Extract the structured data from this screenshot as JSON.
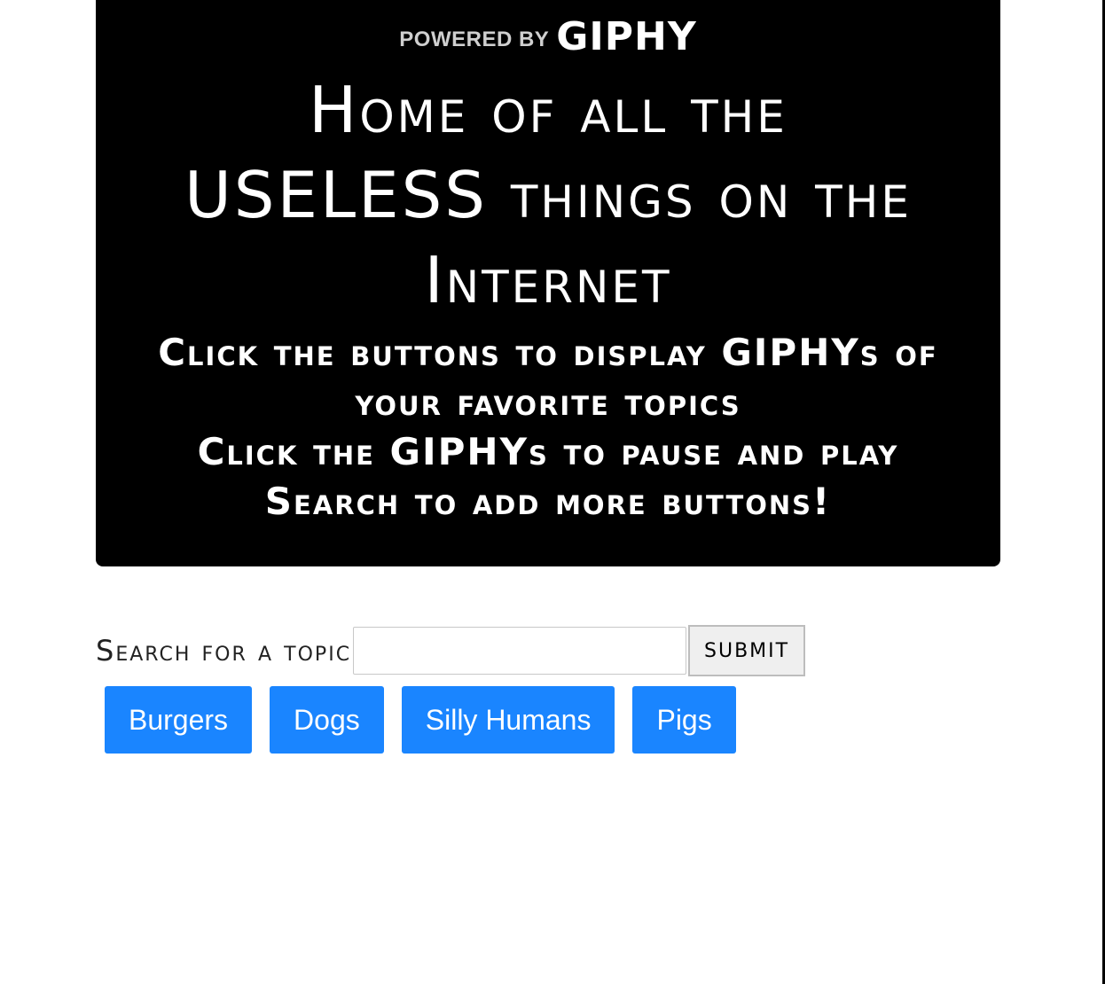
{
  "hero": {
    "powered_by": "POWERED BY",
    "brand": "GIPHY",
    "title": "Home of all the USELESS things on the Internet",
    "subtitle_lines": [
      "Click the buttons to display GIPHYs of your favorite topics",
      "Click the GIPHYs to pause and play",
      "Search to add more buttons!"
    ]
  },
  "search": {
    "label": "Search for a topic",
    "value": "",
    "placeholder": "",
    "submit_label": "SUBMIT"
  },
  "topics": [
    "Burgers",
    "Dogs",
    "Silly Humans",
    "Pigs"
  ],
  "colors": {
    "hero_background": "#000000",
    "topic_button": "#1a85ff",
    "topic_text": "#ffffff"
  }
}
